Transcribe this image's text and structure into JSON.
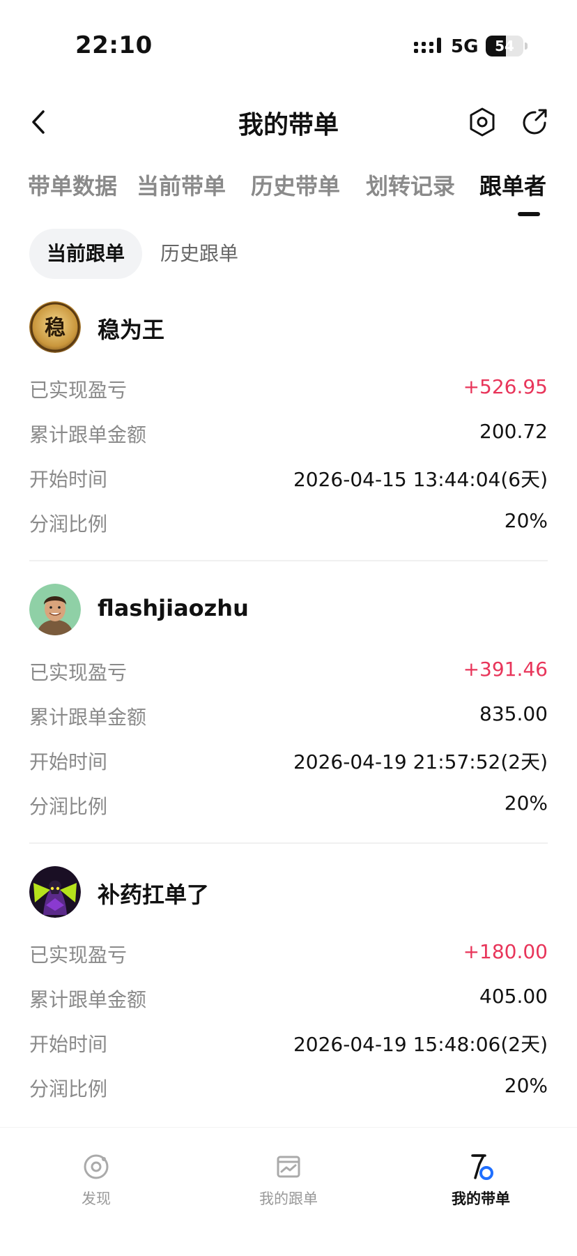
{
  "status_bar": {
    "time": "22:10",
    "network": "5G",
    "battery": "54",
    "battery_level_percent": 54
  },
  "header": {
    "title": "我的带单",
    "back_icon": "chevron-left-icon",
    "settings_icon": "hexagon-settings-icon",
    "share_icon": "share-refresh-icon"
  },
  "tabs": [
    {
      "label": "带单数据",
      "active": false
    },
    {
      "label": "当前带单",
      "active": false
    },
    {
      "label": "历史带单",
      "active": false
    },
    {
      "label": "划转记录",
      "active": false
    },
    {
      "label": "跟单者",
      "active": true
    }
  ],
  "subtabs": [
    {
      "label": "当前跟单",
      "active": true
    },
    {
      "label": "历史跟单",
      "active": false
    }
  ],
  "colors": {
    "profit": "#e8355a",
    "label": "#8a8a8a",
    "text": "#111111",
    "subtab_bg": "#f2f3f5"
  },
  "followers": [
    {
      "name": "稳为王",
      "avatar_char": "稳",
      "stats": [
        {
          "label": "已实现盈亏",
          "value": "+526.95"
        },
        {
          "label": "累计跟单金额",
          "value": "200.72"
        },
        {
          "label": "开始时间",
          "value": "2026-04-15 13:44:04(6天)"
        },
        {
          "label": "分润比例",
          "value": "20%"
        }
      ]
    },
    {
      "name": "flashjiaozhu",
      "avatar_char": "",
      "stats": [
        {
          "label": "已实现盈亏",
          "value": "+391.46"
        },
        {
          "label": "累计跟单金额",
          "value": "835.00"
        },
        {
          "label": "开始时间",
          "value": "2026-04-19 21:57:52(2天)"
        },
        {
          "label": "分润比例",
          "value": "20%"
        }
      ]
    },
    {
      "name": "补药扛单了",
      "avatar_char": "",
      "stats": [
        {
          "label": "已实现盈亏",
          "value": "+180.00"
        },
        {
          "label": "累计跟单金额",
          "value": "405.00"
        },
        {
          "label": "开始时间",
          "value": "2026-04-19 15:48:06(2天)"
        },
        {
          "label": "分润比例",
          "value": "20%"
        }
      ]
    }
  ],
  "bottom_nav": [
    {
      "label": "发现",
      "icon": "discover-icon",
      "active": false
    },
    {
      "label": "我的跟单",
      "icon": "chart-icon",
      "active": false
    },
    {
      "label": "我的带单",
      "icon": "lead-trade-icon",
      "active": true
    }
  ]
}
